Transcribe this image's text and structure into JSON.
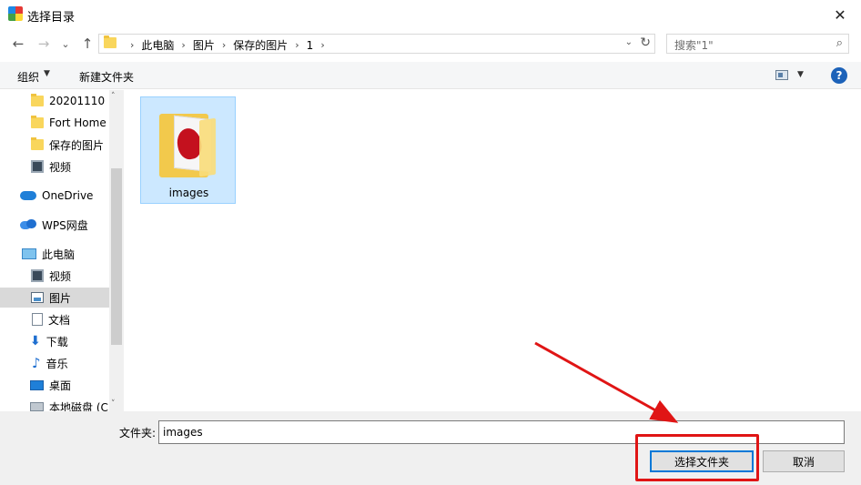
{
  "window": {
    "title": "选择目录",
    "close_glyph": "✕"
  },
  "nav": {
    "back_glyph": "←",
    "forward_glyph": "→",
    "recent_glyph": "⌄",
    "up_glyph": "↑",
    "breadcrumbs": [
      "此电脑",
      "图片",
      "保存的图片",
      "1"
    ],
    "crumb_sep": "›",
    "addr_dropdown_glyph": "⌄",
    "refresh_glyph": "↻",
    "search_placeholder": "搜索\"1\"",
    "search_glyph": "⌕"
  },
  "toolbar": {
    "organize_label": "组织",
    "organize_dd": "▼",
    "new_folder_label": "新建文件夹",
    "view_dd": "▼",
    "help_glyph": "?"
  },
  "sidebar": {
    "items": [
      {
        "label": "20201110",
        "icon": "folder-icon"
      },
      {
        "label": "Fort Home",
        "icon": "folder-icon"
      },
      {
        "label": "保存的图片",
        "icon": "folder-icon"
      },
      {
        "label": "视频",
        "icon": "video-icon"
      },
      {
        "label": "OneDrive",
        "icon": "onedrive-icon"
      },
      {
        "label": "WPS网盘",
        "icon": "wps-cloud-icon"
      },
      {
        "label": "此电脑",
        "icon": "pc-icon"
      },
      {
        "label": "视频",
        "icon": "video-icon"
      },
      {
        "label": "图片",
        "icon": "pictures-icon",
        "selected": true
      },
      {
        "label": "文档",
        "icon": "documents-icon"
      },
      {
        "label": "下载",
        "icon": "download-icon"
      },
      {
        "label": "音乐",
        "icon": "music-icon"
      },
      {
        "label": "桌面",
        "icon": "desktop-icon"
      },
      {
        "label": "本地磁盘 (C",
        "icon": "disk-icon"
      }
    ],
    "scroll_up": "˄",
    "scroll_down": "˅"
  },
  "content": {
    "items": [
      {
        "label": "images",
        "icon": "folder-with-strawberry-icon",
        "selected": true
      }
    ]
  },
  "footer": {
    "folder_label": "文件夹:",
    "folder_value": "images",
    "select_button": "选择文件夹",
    "cancel_button": "取消"
  },
  "annotation": {
    "color": "#e01515"
  }
}
